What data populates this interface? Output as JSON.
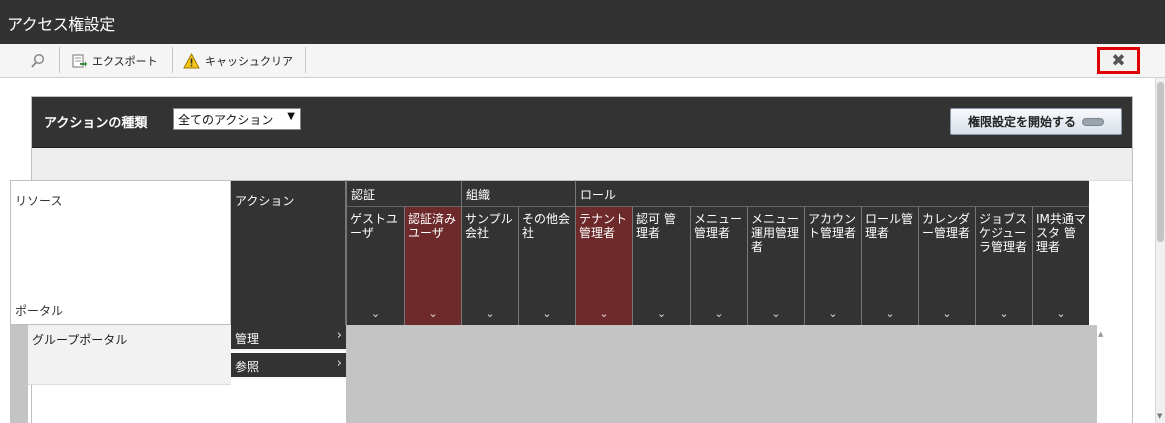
{
  "window": {
    "title": "アクセス権設定"
  },
  "toolbar": {
    "export_label": "エクスポート",
    "cache_clear_label": "キャッシュクリア",
    "close_glyph": "✖",
    "search_icon": "search-icon",
    "export_icon": "export-icon",
    "warning_icon": "warning-icon"
  },
  "filter": {
    "label": "アクションの種類",
    "selected": "全てのアクション",
    "start_button": "権限設定を開始する"
  },
  "grid": {
    "resource_header": "リソース",
    "portal_header": "ポータル",
    "action_header": "アクション",
    "groups": [
      "認証",
      "組織",
      "ロール"
    ],
    "columns": [
      "ゲストユーザ",
      "認証済みユーザ",
      "サンプル会社",
      "その他会社",
      "テナント管理者",
      "認可 管理者",
      "メニュー管理者",
      "メニュー運用管理者",
      "アカウント管理者",
      "ロール管理者",
      "カレンダー管理者",
      "ジョブスケジューラ管理者",
      "IM共通マスタ 管理者"
    ],
    "rows": [
      {
        "resource": "グループポータル",
        "action": "管理",
        "perms": [
          "deny",
          "deny",
          "deny",
          "deny",
          "allow",
          "deny",
          "deny",
          "deny",
          "deny",
          "deny",
          "deny",
          "deny",
          "deny"
        ]
      },
      {
        "resource": "",
        "action": "参照",
        "perms": [
          "allow",
          "allow",
          "deny",
          "deny",
          "deny",
          "deny",
          "deny",
          "deny",
          "deny",
          "deny",
          "deny",
          "deny",
          "deny"
        ]
      }
    ],
    "colors": {
      "header": "#333333",
      "selected_header": "#6e2a2a",
      "allow": "#4aa336",
      "deny": "#e0585f",
      "highlight": "#fff7d9"
    }
  }
}
